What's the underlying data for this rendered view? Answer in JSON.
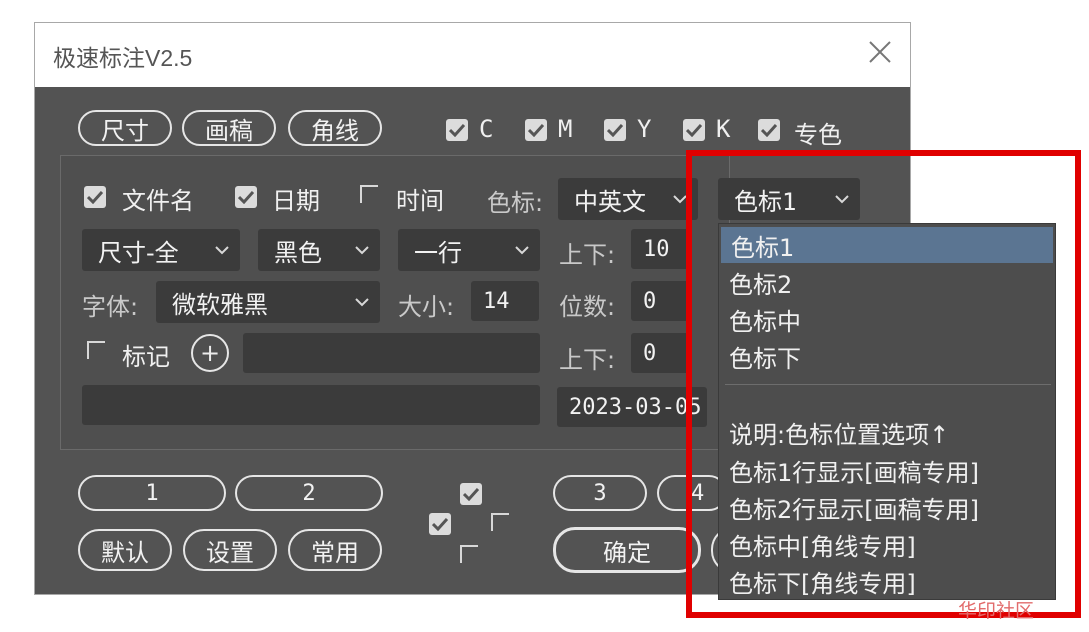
{
  "window": {
    "title": "极速标注V2.5"
  },
  "top_buttons": [
    "尺寸",
    "画稿",
    "角线"
  ],
  "channels": [
    {
      "label": "C",
      "checked": true
    },
    {
      "label": "M",
      "checked": true
    },
    {
      "label": "Y",
      "checked": true
    },
    {
      "label": "K",
      "checked": true
    },
    {
      "label": "专色",
      "checked": true
    }
  ],
  "row1": {
    "filename_label": "文件名",
    "filename_checked": true,
    "date_label": "日期",
    "date_checked": true,
    "time_label": "时间",
    "time_checked": false,
    "colormark_label": "色标:",
    "lang_value": "中英文",
    "colormark_value": "色标1"
  },
  "row2": {
    "size_value": "尺寸-全",
    "color_value": "黑色",
    "lines_value": "一行",
    "updown_label": "上下:",
    "updown_value": "10"
  },
  "row3": {
    "font_label": "字体:",
    "font_value": "微软雅黑",
    "size_label": "大小:",
    "size_value": "14",
    "digits_label": "位数:",
    "digits_value": "0"
  },
  "row4": {
    "mark_label": "标记",
    "mark_checked": false,
    "add_symbol": "+",
    "mark_value": "",
    "updown_label": "上下:",
    "updown_value": "0"
  },
  "row5": {
    "note_value": "",
    "date_value": "2023-03-05"
  },
  "bottom": {
    "preset_buttons": [
      "1",
      "2"
    ],
    "preset_buttons_right": [
      "3",
      "4"
    ],
    "action_buttons": [
      "默认",
      "设置",
      "常用"
    ],
    "confirm_label": "确定"
  },
  "popup": {
    "options": [
      "色标1",
      "色标2",
      "色标中",
      "色标下"
    ],
    "selected_index": 0,
    "notes": [
      "说明:色标位置选项↑",
      "色标1行显示[画稿专用]",
      "色标2行显示[画稿专用]",
      "色标中[角线专用]",
      "色标下[角线专用]"
    ]
  },
  "watermark": "华印社区",
  "colors": {
    "panel": "#535353",
    "field": "#3b3b3b",
    "highlight": "#5b7592",
    "annotation": "#e00000"
  }
}
